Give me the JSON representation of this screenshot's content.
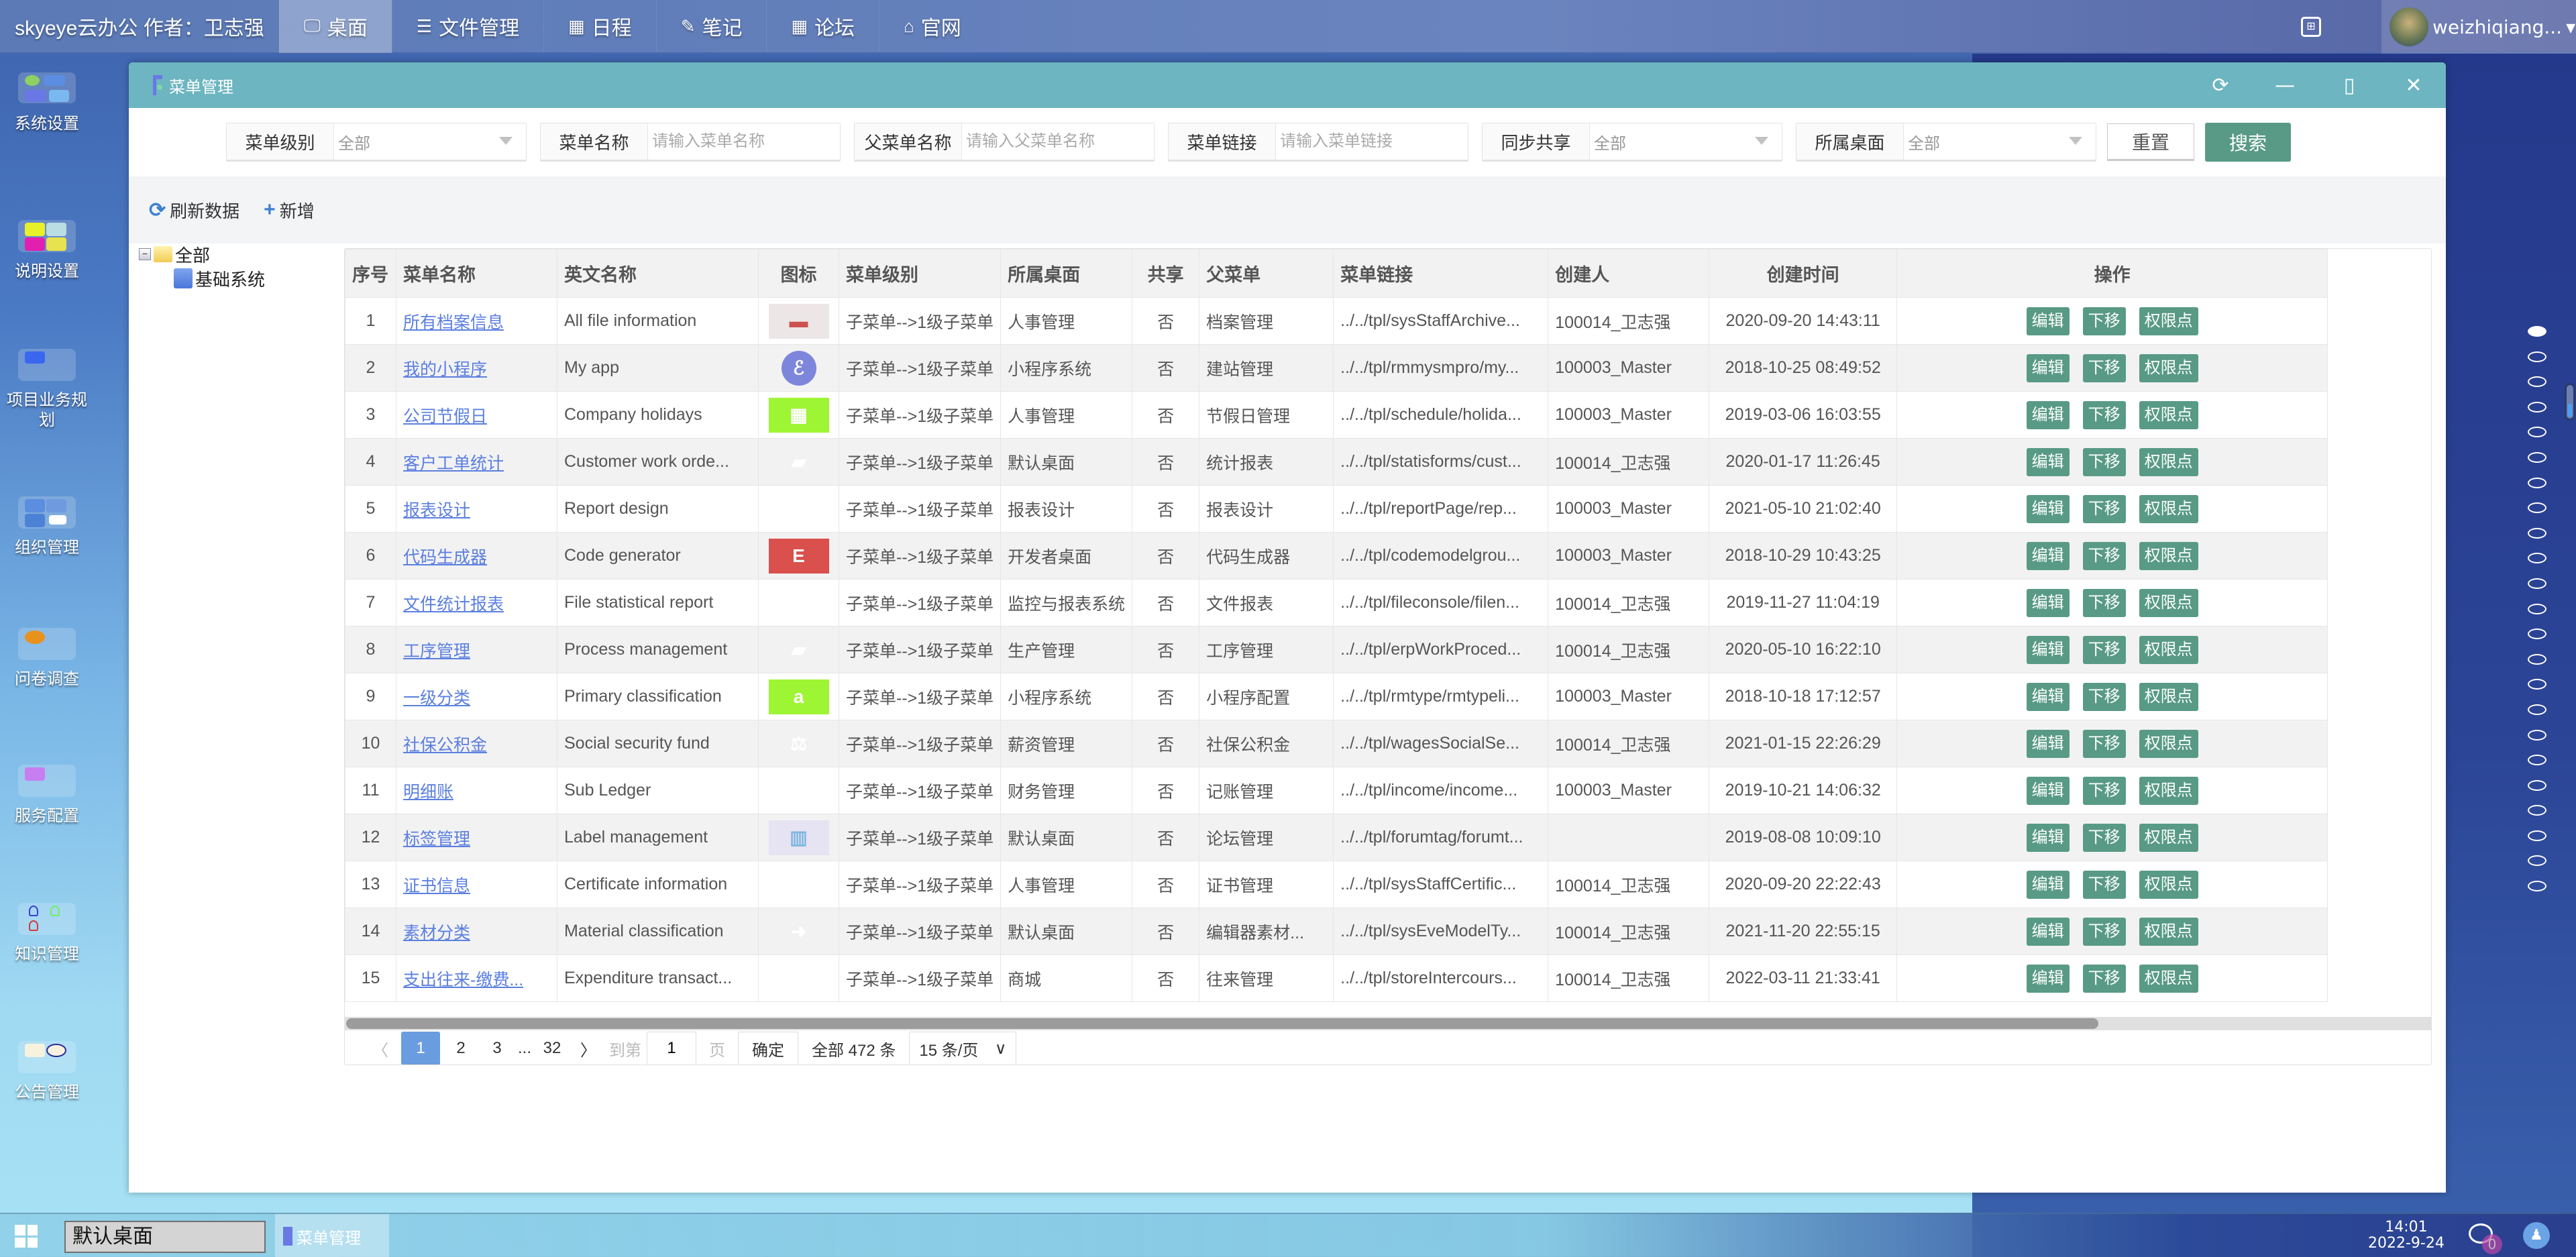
{
  "topbar": {
    "brand": "skyeye云办公 作者：卫志强",
    "nav": [
      {
        "icon": "monitor-icon",
        "glyph": "🖵",
        "label": "桌面",
        "active": true
      },
      {
        "icon": "list-icon",
        "glyph": "☰",
        "label": "文件管理"
      },
      {
        "icon": "calendar-icon",
        "glyph": "▦",
        "label": "日程"
      },
      {
        "icon": "edit-icon",
        "glyph": "✎",
        "label": "笔记"
      },
      {
        "icon": "calendar-icon",
        "glyph": "▦",
        "label": "论坛"
      },
      {
        "icon": "home-icon",
        "glyph": "⌂",
        "label": "官网"
      }
    ],
    "username": "weizhiqiang...",
    "user_caret": "▾"
  },
  "desktop_icons": [
    {
      "label": "系统设置"
    },
    {
      "label": "说明设置"
    },
    {
      "label": "项目业务规划"
    },
    {
      "label": "组织管理"
    },
    {
      "label": "问卷调查"
    },
    {
      "label": "服务配置"
    },
    {
      "label": "知识管理"
    },
    {
      "label": "公告管理"
    }
  ],
  "window": {
    "title": "菜单管理",
    "controls": {
      "refresh": "⟳",
      "minimize": "—",
      "maximize": "▯",
      "close": "✕"
    }
  },
  "filters": [
    {
      "label": "菜单级别",
      "type": "select",
      "value": "全部"
    },
    {
      "label": "菜单名称",
      "type": "input",
      "placeholder": "请输入菜单名称"
    },
    {
      "label": "父菜单名称",
      "type": "input",
      "placeholder": "请输入父菜单名称"
    },
    {
      "label": "菜单链接",
      "type": "input",
      "placeholder": "请输入菜单链接"
    },
    {
      "label": "同步共享",
      "type": "select",
      "value": "全部"
    },
    {
      "label": "所属桌面",
      "type": "select",
      "value": "全部"
    }
  ],
  "filter_buttons": {
    "reset": "重置",
    "search": "搜索"
  },
  "toolbar": {
    "refresh": "刷新数据",
    "add": "新增",
    "refresh_glyph": "⟳",
    "add_glyph": "+"
  },
  "tree": {
    "root": "全部",
    "children": [
      "基础系统"
    ]
  },
  "table": {
    "columns": [
      "序号",
      "菜单名称",
      "英文名称",
      "图标",
      "菜单级别",
      "所属桌面",
      "共享",
      "父菜单",
      "菜单链接",
      "创建人",
      "创建时间",
      "操作"
    ],
    "actions": [
      "编辑",
      "下移",
      "权限点"
    ],
    "rows": [
      {
        "no": "1",
        "name": "所有档案信息",
        "en": "All file information",
        "icon": {
          "type": "archive",
          "bg": "#ede6e6",
          "fg": "#cc5250",
          "glyph": "▬"
        },
        "level": "子菜单-->1级子菜单",
        "desk": "人事管理",
        "share": "否",
        "parent": "档案管理",
        "link": "../../tpl/sysStaffArchive...",
        "creator": "100014_卫志强",
        "time": "2020-09-20 14:43:11"
      },
      {
        "no": "2",
        "name": "我的小程序",
        "en": "My app",
        "icon": {
          "type": "miniprogram",
          "bg": "#7e86dc",
          "fg": "#ffffff",
          "glyph": "ℰ",
          "round": true
        },
        "level": "子菜单-->1级子菜单",
        "desk": "小程序系统",
        "share": "否",
        "parent": "建站管理",
        "link": "../../tpl/rmmysmpro/my...",
        "creator": "100003_Master",
        "time": "2018-10-25 08:49:52"
      },
      {
        "no": "3",
        "name": "公司节假日",
        "en": "Company holidays",
        "icon": {
          "type": "calendar",
          "bg": "#9ef534",
          "fg": "#ffffff",
          "glyph": "▦"
        },
        "level": "子菜单-->1级子菜单",
        "desk": "人事管理",
        "share": "否",
        "parent": "节假日管理",
        "link": "../../tpl/schedule/holida...",
        "creator": "100003_Master",
        "time": "2019-03-06 16:03:55"
      },
      {
        "no": "4",
        "name": "客户工单统计",
        "en": "Customer work orde...",
        "icon": {
          "type": "folder-open",
          "bg": "transparent",
          "fg": "#ffffff",
          "glyph": "▰"
        },
        "level": "子菜单-->1级子菜单",
        "desk": "默认桌面",
        "share": "否",
        "parent": "统计报表",
        "link": "../../tpl/statisforms/cust...",
        "creator": "100014_卫志强",
        "time": "2020-01-17 11:26:45"
      },
      {
        "no": "5",
        "name": "报表设计",
        "en": "Report design",
        "icon": {
          "type": "archive",
          "bg": "transparent",
          "fg": "#ffffff",
          "glyph": "▬"
        },
        "level": "子菜单-->1级子菜单",
        "desk": "报表设计",
        "share": "否",
        "parent": "报表设计",
        "link": "../../tpl/reportPage/rep...",
        "creator": "100003_Master",
        "time": "2021-05-10 21:02:40"
      },
      {
        "no": "6",
        "name": "代码生成器",
        "en": "Code generator",
        "icon": {
          "type": "letter-e",
          "bg": "#d9504d",
          "fg": "#ffffff",
          "glyph": "E"
        },
        "level": "子菜单-->1级子菜单",
        "desk": "开发者桌面",
        "share": "否",
        "parent": "代码生成器",
        "link": "../../tpl/codemodelgrou...",
        "creator": "100003_Master",
        "time": "2018-10-29 10:43:25"
      },
      {
        "no": "7",
        "name": "文件统计报表",
        "en": "File statistical report",
        "icon": null,
        "level": "子菜单-->1级子菜单",
        "desk": "监控与报表系统",
        "share": "否",
        "parent": "文件报表",
        "link": "../../tpl/fileconsole/filen...",
        "creator": "100014_卫志强",
        "time": "2019-11-27 11:04:19"
      },
      {
        "no": "8",
        "name": "工序管理",
        "en": "Process management",
        "icon": {
          "type": "folder-open",
          "bg": "transparent",
          "fg": "#ffffff",
          "glyph": "▰"
        },
        "level": "子菜单-->1级子菜单",
        "desk": "生产管理",
        "share": "否",
        "parent": "工序管理",
        "link": "../../tpl/erpWorkProced...",
        "creator": "100014_卫志强",
        "time": "2020-05-10 16:22:10"
      },
      {
        "no": "9",
        "name": "一级分类",
        "en": "Primary classification",
        "icon": {
          "type": "amazon",
          "bg": "#9ef534",
          "fg": "#ffffff",
          "glyph": "a"
        },
        "level": "子菜单-->1级子菜单",
        "desk": "小程序系统",
        "share": "否",
        "parent": "小程序配置",
        "link": "../../tpl/rmtype/rmtypeli...",
        "creator": "100003_Master",
        "time": "2018-10-18 17:12:57"
      },
      {
        "no": "10",
        "name": "社保公积金",
        "en": "Social security fund",
        "icon": {
          "type": "balance-scale",
          "bg": "transparent",
          "fg": "#ffffff",
          "glyph": "⚖"
        },
        "level": "子菜单-->1级子菜单",
        "desk": "薪资管理",
        "share": "否",
        "parent": "社保公积金",
        "link": "../../tpl/wagesSocialSe...",
        "creator": "100014_卫志强",
        "time": "2021-01-15 22:26:29"
      },
      {
        "no": "11",
        "name": "明细账",
        "en": "Sub Ledger",
        "icon": null,
        "level": "子菜单-->1级子菜单",
        "desk": "财务管理",
        "share": "否",
        "parent": "记账管理",
        "link": "../../tpl/income/income...",
        "creator": "100003_Master",
        "time": "2019-10-21 14:06:32"
      },
      {
        "no": "12",
        "name": "标签管理",
        "en": "Label management",
        "icon": {
          "type": "hospital",
          "bg": "#e6e3f2",
          "fg": "#7fb6e0",
          "glyph": "▥"
        },
        "level": "子菜单-->1级子菜单",
        "desk": "默认桌面",
        "share": "否",
        "parent": "论坛管理",
        "link": "../../tpl/forumtag/forumt...",
        "creator": "",
        "time": "2019-08-08 10:09:10"
      },
      {
        "no": "13",
        "name": "证书信息",
        "en": "Certificate information",
        "icon": null,
        "level": "子菜单-->1级子菜单",
        "desk": "人事管理",
        "share": "否",
        "parent": "证书管理",
        "link": "../../tpl/sysStaffCertific...",
        "creator": "100014_卫志强",
        "time": "2020-09-20 22:22:43"
      },
      {
        "no": "14",
        "name": "素材分类",
        "en": "Material classification",
        "icon": {
          "type": "file-import",
          "bg": "transparent",
          "fg": "#ffffff",
          "glyph": "➜"
        },
        "level": "子菜单-->1级子菜单",
        "desk": "默认桌面",
        "share": "否",
        "parent": "编辑器素材...",
        "link": "../../tpl/sysEveModelTy...",
        "creator": "100014_卫志强",
        "time": "2021-11-20 22:55:15"
      },
      {
        "no": "15",
        "name": "支出往来-缴费...",
        "en": "Expenditure transact...",
        "icon": null,
        "level": "子菜单-->1级子菜单",
        "desk": "商城",
        "share": "否",
        "parent": "往来管理",
        "link": "../../tpl/storeIntercours...",
        "creator": "100014_卫志强",
        "time": "2022-03-11 21:33:41"
      }
    ]
  },
  "pagination": {
    "prev": "〈",
    "pages": [
      "1",
      "2",
      "3"
    ],
    "ellipsis": "...",
    "last": "32",
    "next": "〉",
    "goto_label": "到第",
    "goto_value": "1",
    "page_unit": "页",
    "confirm": "确定",
    "total": "全部 472 条",
    "page_size": "15 条/页",
    "page_size_caret": "∨",
    "current": 1
  },
  "horizontal_scroll_fraction": 0.84,
  "right_dots": {
    "count": 23,
    "active_index": 0
  },
  "taskbar": {
    "desktop": "默认桌面",
    "task": "菜单管理",
    "time": "14:01",
    "date": "2022-9-24",
    "unread": "0"
  }
}
